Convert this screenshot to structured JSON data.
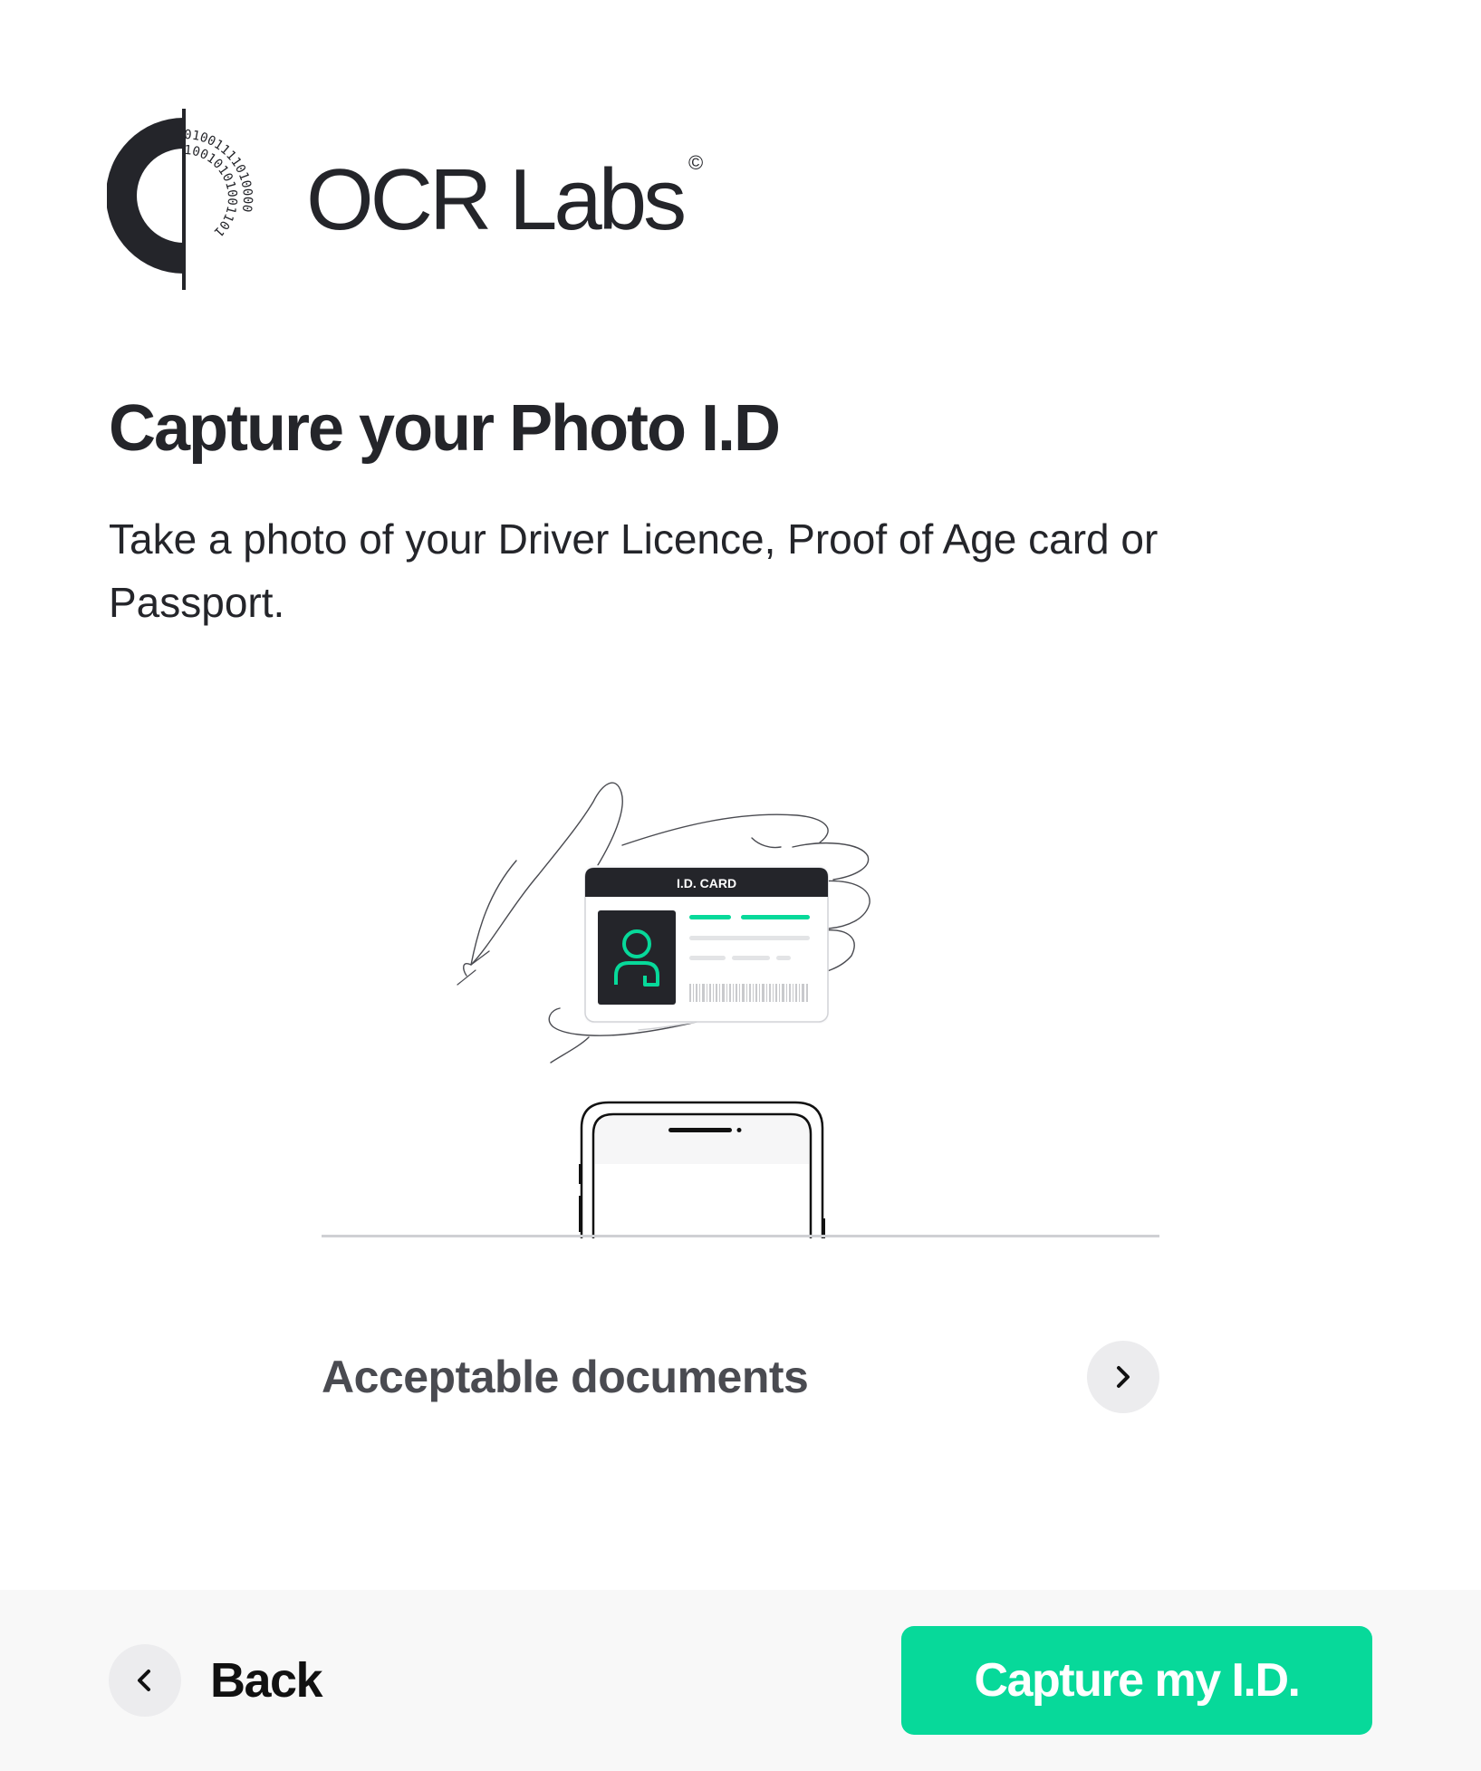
{
  "brand": {
    "name": "OCR Labs",
    "copyright_symbol": "©",
    "logo_binary_outer": "01001111010000",
    "logo_binary_inner": "10010101001101",
    "accent_color": "#07d99a"
  },
  "header": {
    "title": "Capture your Photo I.D",
    "subtitle": "Take a photo of your Driver Licence, Proof of Age card or Passport."
  },
  "illustration": {
    "card_header": "I.D. CARD"
  },
  "documents_link": {
    "label": "Acceptable documents",
    "icon": "chevron-right-icon"
  },
  "footer": {
    "back_label": "Back",
    "back_icon": "chevron-left-icon",
    "capture_label": "Capture my I.D."
  }
}
